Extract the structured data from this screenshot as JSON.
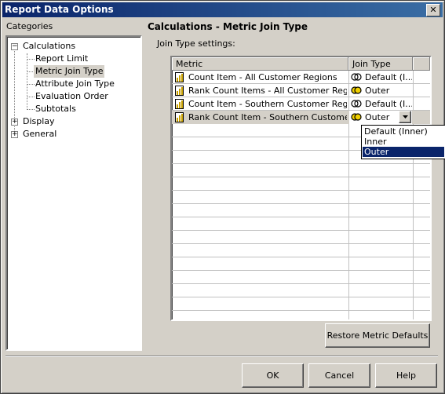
{
  "window": {
    "title": "Report Data Options",
    "close_glyph": "✕"
  },
  "categories": {
    "label": "Categories",
    "tree": {
      "calculations": "Calculations",
      "report_limit": "Report Limit",
      "metric_join_type": "Metric Join Type",
      "attribute_join_type": "Attribute Join Type",
      "evaluation_order": "Evaluation Order",
      "subtotals": "Subtotals",
      "display": "Display",
      "general": "General"
    }
  },
  "panel": {
    "title": "Calculations - Metric Join Type",
    "subtitle": "Join Type settings:"
  },
  "grid": {
    "columns": [
      "Metric",
      "Join Type"
    ],
    "rows": [
      {
        "metric": "Count Item - All Customer Regions",
        "join": "Default (I..."
      },
      {
        "metric": "Rank Count Items - All Customer Regions",
        "join": "Outer"
      },
      {
        "metric": "Count Item - Southern Customer Regions",
        "join": "Default (I..."
      },
      {
        "metric": "Rank Count Item - Southern Customer R...",
        "join": "Outer"
      }
    ],
    "dropdown_options": [
      "Default (Inner)",
      "Inner",
      "Outer"
    ],
    "dropdown_selected": "Outer"
  },
  "buttons": {
    "restore": "Restore Metric Defaults",
    "ok": "OK",
    "cancel": "Cancel",
    "help": "Help"
  },
  "colors": {
    "title_bar": "#0a246a",
    "selection": "#0a246a",
    "face": "#d4d0c8"
  }
}
